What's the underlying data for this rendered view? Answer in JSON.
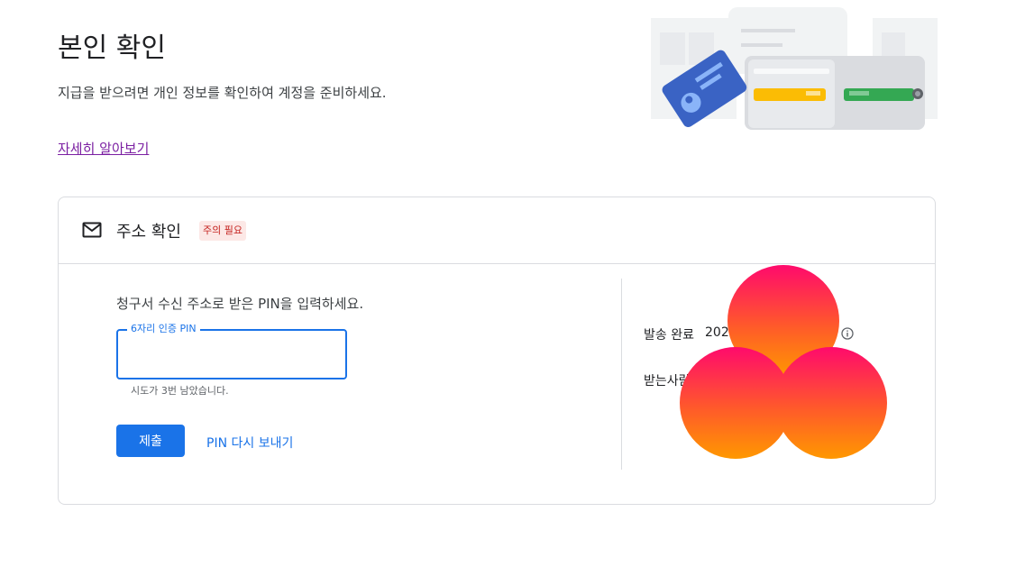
{
  "header": {
    "title": "본인 확인",
    "description": "지급을 받으려면 개인 정보를 확인하여 계정을 준비하세요.",
    "learn_more": "자세히 알아보기"
  },
  "hero": {
    "icon": "wallet-id-card-illustration"
  },
  "address_card": {
    "icon": "mail-icon",
    "title": "주소 확인",
    "badge": "주의 필요",
    "badge_color": "#c5221f",
    "prompt": "청구서 수신 주소로 받은 PIN을 입력하세요.",
    "pin_label": "6자리 인증 PIN",
    "pin_value": "",
    "attempts_text": "시도가 3번 남았습니다.",
    "submit_label": "제출",
    "resend_label": "PIN 다시 보내기",
    "sent_label": "발송 완료",
    "sent_value": "202",
    "recipient_label": "받는사람"
  },
  "colors": {
    "accent": "#1a73e8",
    "link_visited": "#7b1fa2"
  },
  "overlay": {
    "icon": "trefoil-logo-overlay"
  }
}
